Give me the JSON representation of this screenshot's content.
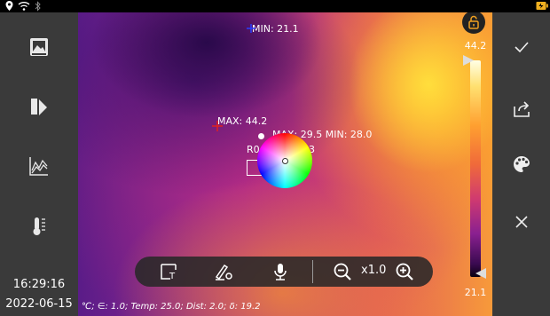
{
  "status_bar": {
    "icons": [
      "location-pin-icon",
      "wifi-icon",
      "bluetooth-icon",
      "battery-charging-icon"
    ]
  },
  "left_sidebar": {
    "buttons": [
      "gallery-icon",
      "palette-mode-icon",
      "chart-icon",
      "thermometer-icon"
    ],
    "time": "16:29:16",
    "date": "2022-06-15"
  },
  "right_sidebar": {
    "buttons": [
      "check-icon",
      "share-icon",
      "palette-icon",
      "close-icon"
    ]
  },
  "thermal": {
    "min_label": "MIN: 21.1",
    "max_label": "MAX: 44.2",
    "roi_stats": "MAX: 29.5 MIN: 28.0",
    "roi_name_prefix": "R0",
    "roi_name_suffix": "3",
    "scale_max": "44.2",
    "scale_min": "21.1",
    "zoom": "x1.0",
    "params": "℃; ∈: 1.0; Temp: 25.0; Dist: 2.0; δ: 19.2"
  },
  "toolbar": {
    "buttons": [
      "roi-tool-icon",
      "edit-settings-icon",
      "microphone-icon",
      "zoom-out-icon",
      "zoom-in-icon"
    ]
  },
  "colors": {
    "sidebar_bg": "#3a3a3a",
    "toolbar_bg": "#282828",
    "cold": "#3a0a50",
    "hot": "#ffe070"
  }
}
